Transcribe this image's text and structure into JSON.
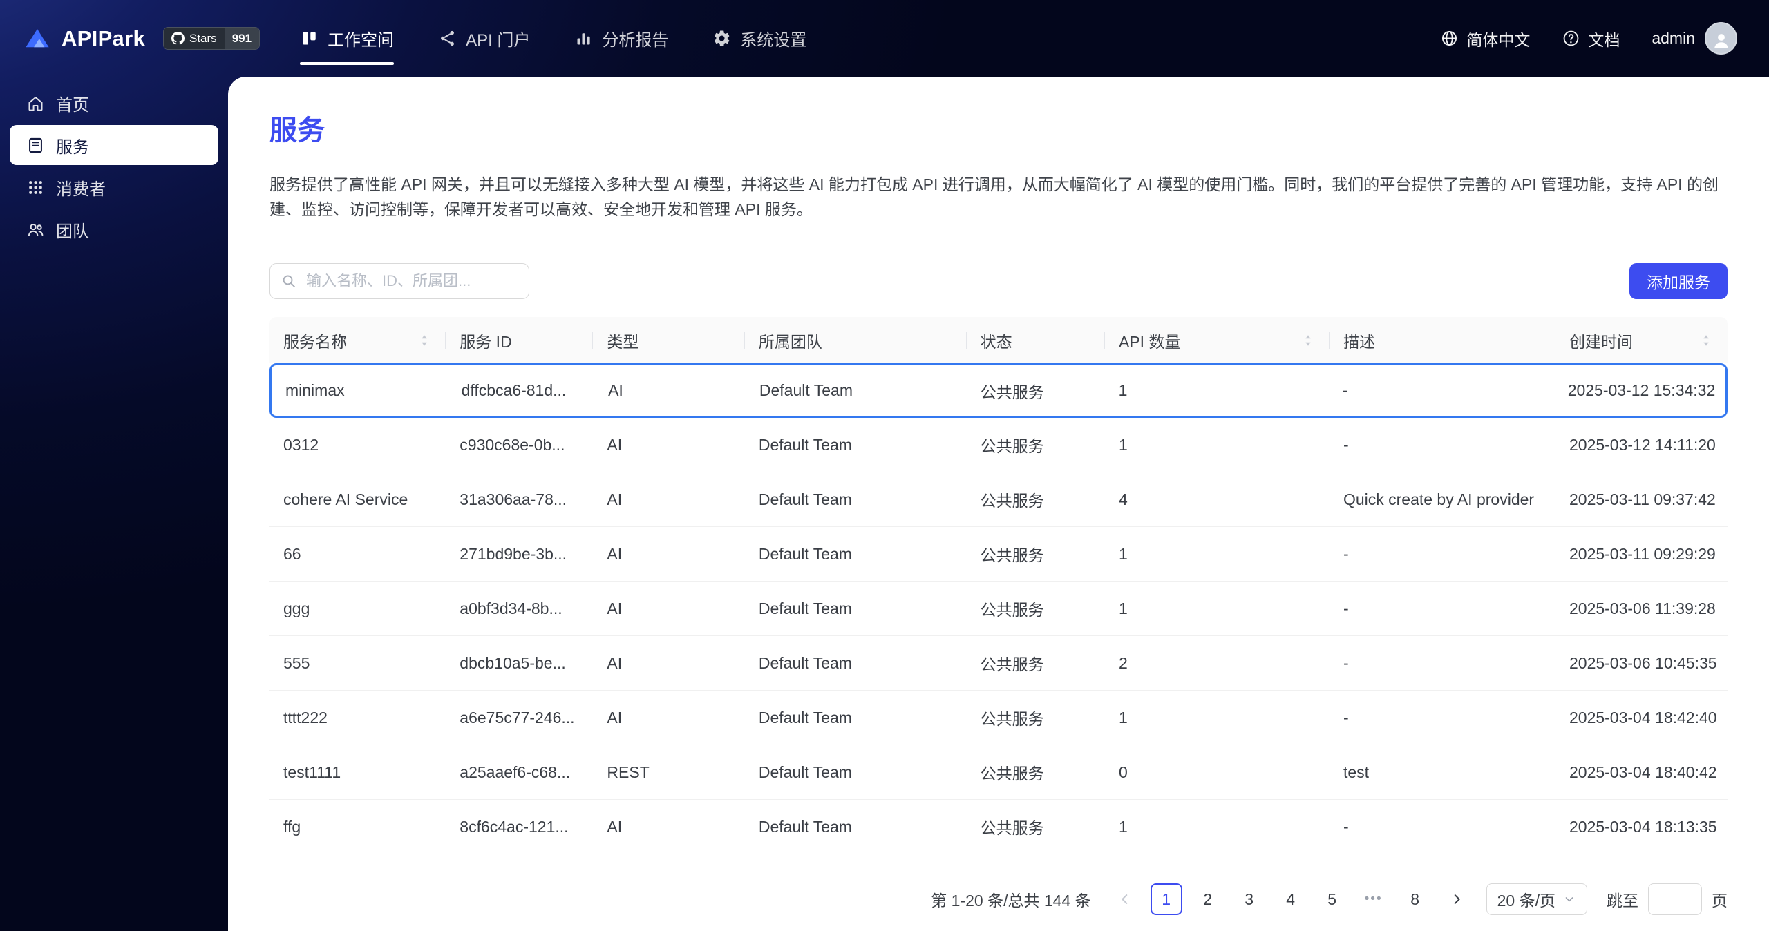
{
  "colors": {
    "accent": "#3d4cf0",
    "highlight": "#3478f0"
  },
  "brand": {
    "name": "APIPark",
    "stars_label": "Stars",
    "stars_count": "991"
  },
  "topnav": {
    "items": [
      {
        "name": "workspace",
        "label": "工作空间",
        "icon": "workspace-icon",
        "active": true
      },
      {
        "name": "api-portal",
        "label": "API 门户",
        "icon": "portal-icon",
        "active": false
      },
      {
        "name": "analytics",
        "label": "分析报告",
        "icon": "analytics-icon",
        "active": false
      },
      {
        "name": "settings",
        "label": "系统设置",
        "icon": "settings-icon",
        "active": false
      }
    ]
  },
  "topbar_right": {
    "language": "简体中文",
    "docs": "文档",
    "user": "admin"
  },
  "sidebar": {
    "items": [
      {
        "name": "home",
        "label": "首页",
        "icon": "home-icon",
        "active": false
      },
      {
        "name": "services",
        "label": "服务",
        "icon": "services-icon",
        "active": true
      },
      {
        "name": "consumers",
        "label": "消费者",
        "icon": "consumers-icon",
        "active": false
      },
      {
        "name": "teams",
        "label": "团队",
        "icon": "teams-icon",
        "active": false
      }
    ]
  },
  "page": {
    "title": "服务",
    "description": "服务提供了高性能 API 网关，并且可以无缝接入多种大型 AI 模型，并将这些 AI 能力打包成 API 进行调用，从而大幅简化了 AI 模型的使用门槛。同时，我们的平台提供了完善的 API 管理功能，支持 API 的创建、监控、访问控制等，保障开发者可以高效、安全地开发和管理 API 服务。",
    "search_placeholder": "输入名称、ID、所属团...",
    "add_button": "添加服务"
  },
  "table": {
    "columns": [
      {
        "key": "name",
        "label": "服务名称",
        "sortable": true
      },
      {
        "key": "id",
        "label": "服务 ID",
        "sortable": false
      },
      {
        "key": "type",
        "label": "类型",
        "sortable": false
      },
      {
        "key": "team",
        "label": "所属团队",
        "sortable": false
      },
      {
        "key": "status",
        "label": "状态",
        "sortable": false
      },
      {
        "key": "api_count",
        "label": "API 数量",
        "sortable": true
      },
      {
        "key": "desc",
        "label": "描述",
        "sortable": false
      },
      {
        "key": "created",
        "label": "创建时间",
        "sortable": true
      }
    ],
    "rows": [
      {
        "name": "minimax",
        "id": "dffcbca6-81d...",
        "type": "AI",
        "team": "Default Team",
        "status": "公共服务",
        "api_count": "1",
        "desc": "-",
        "created": "2025-03-12 15:34:32",
        "highlight": true
      },
      {
        "name": "0312",
        "id": "c930c68e-0b...",
        "type": "AI",
        "team": "Default Team",
        "status": "公共服务",
        "api_count": "1",
        "desc": "-",
        "created": "2025-03-12 14:11:20",
        "highlight": false
      },
      {
        "name": "cohere AI Service",
        "id": "31a306aa-78...",
        "type": "AI",
        "team": "Default Team",
        "status": "公共服务",
        "api_count": "4",
        "desc": "Quick create by AI provider",
        "created": "2025-03-11 09:37:42",
        "highlight": false
      },
      {
        "name": "66",
        "id": "271bd9be-3b...",
        "type": "AI",
        "team": "Default Team",
        "status": "公共服务",
        "api_count": "1",
        "desc": "-",
        "created": "2025-03-11 09:29:29",
        "highlight": false
      },
      {
        "name": "ggg",
        "id": "a0bf3d34-8b...",
        "type": "AI",
        "team": "Default Team",
        "status": "公共服务",
        "api_count": "1",
        "desc": "-",
        "created": "2025-03-06 11:39:28",
        "highlight": false
      },
      {
        "name": "555",
        "id": "dbcb10a5-be...",
        "type": "AI",
        "team": "Default Team",
        "status": "公共服务",
        "api_count": "2",
        "desc": "-",
        "created": "2025-03-06 10:45:35",
        "highlight": false
      },
      {
        "name": "tttt222",
        "id": "a6e75c77-246...",
        "type": "AI",
        "team": "Default Team",
        "status": "公共服务",
        "api_count": "1",
        "desc": "-",
        "created": "2025-03-04 18:42:40",
        "highlight": false
      },
      {
        "name": "test1111",
        "id": "a25aaef6-c68...",
        "type": "REST",
        "team": "Default Team",
        "status": "公共服务",
        "api_count": "0",
        "desc": "test",
        "created": "2025-03-04 18:40:42",
        "highlight": false
      },
      {
        "name": "ffg",
        "id": "8cf6c4ac-121...",
        "type": "AI",
        "team": "Default Team",
        "status": "公共服务",
        "api_count": "1",
        "desc": "-",
        "created": "2025-03-04 18:13:35",
        "highlight": false
      }
    ]
  },
  "pagination": {
    "total_text": "第 1-20 条/总共 144 条",
    "pages": [
      "1",
      "2",
      "3",
      "4",
      "5",
      "•••",
      "8"
    ],
    "active_page": "1",
    "page_size": "20 条/页",
    "jump_label": "跳至",
    "jump_suffix": "页"
  }
}
